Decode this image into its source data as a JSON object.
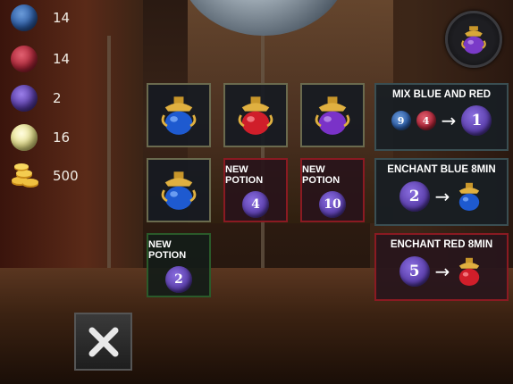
{
  "resources": [
    {
      "name": "blue",
      "color": "#2f5fa8",
      "count": "14"
    },
    {
      "name": "red",
      "color": "#b0283a",
      "count": "14"
    },
    {
      "name": "purple",
      "color": "#5a3ea8",
      "count": "2"
    },
    {
      "name": "yellow",
      "color": "#e6e08a",
      "count": "16"
    },
    {
      "name": "gold-coins",
      "color": "#e0a82a",
      "count": "500"
    }
  ],
  "cauldron_button": {
    "icon": "potion-icon"
  },
  "inventory": [
    {
      "type": "potion",
      "color": "blue"
    },
    {
      "type": "potion",
      "color": "red"
    },
    {
      "type": "potion",
      "color": "purple"
    },
    {
      "type": "potion",
      "color": "blue"
    },
    {
      "type": "new",
      "label": "NEW POTION",
      "value": "4"
    },
    {
      "type": "new",
      "label": "NEW POTION",
      "value": "10"
    },
    {
      "type": "new",
      "label": "NEW POTION",
      "value": "2"
    }
  ],
  "recipes": [
    {
      "title": "MIX BLUE AND RED",
      "inputs": [
        "9",
        "4"
      ],
      "output": "1"
    },
    {
      "title": "ENCHANT BLUE 8MIN",
      "input": "2",
      "output_potion": "blue"
    },
    {
      "title": "ENCHANT RED 8MIN",
      "input": "5",
      "output_potion": "red"
    }
  ],
  "close_button": {
    "icon": "close-icon"
  }
}
